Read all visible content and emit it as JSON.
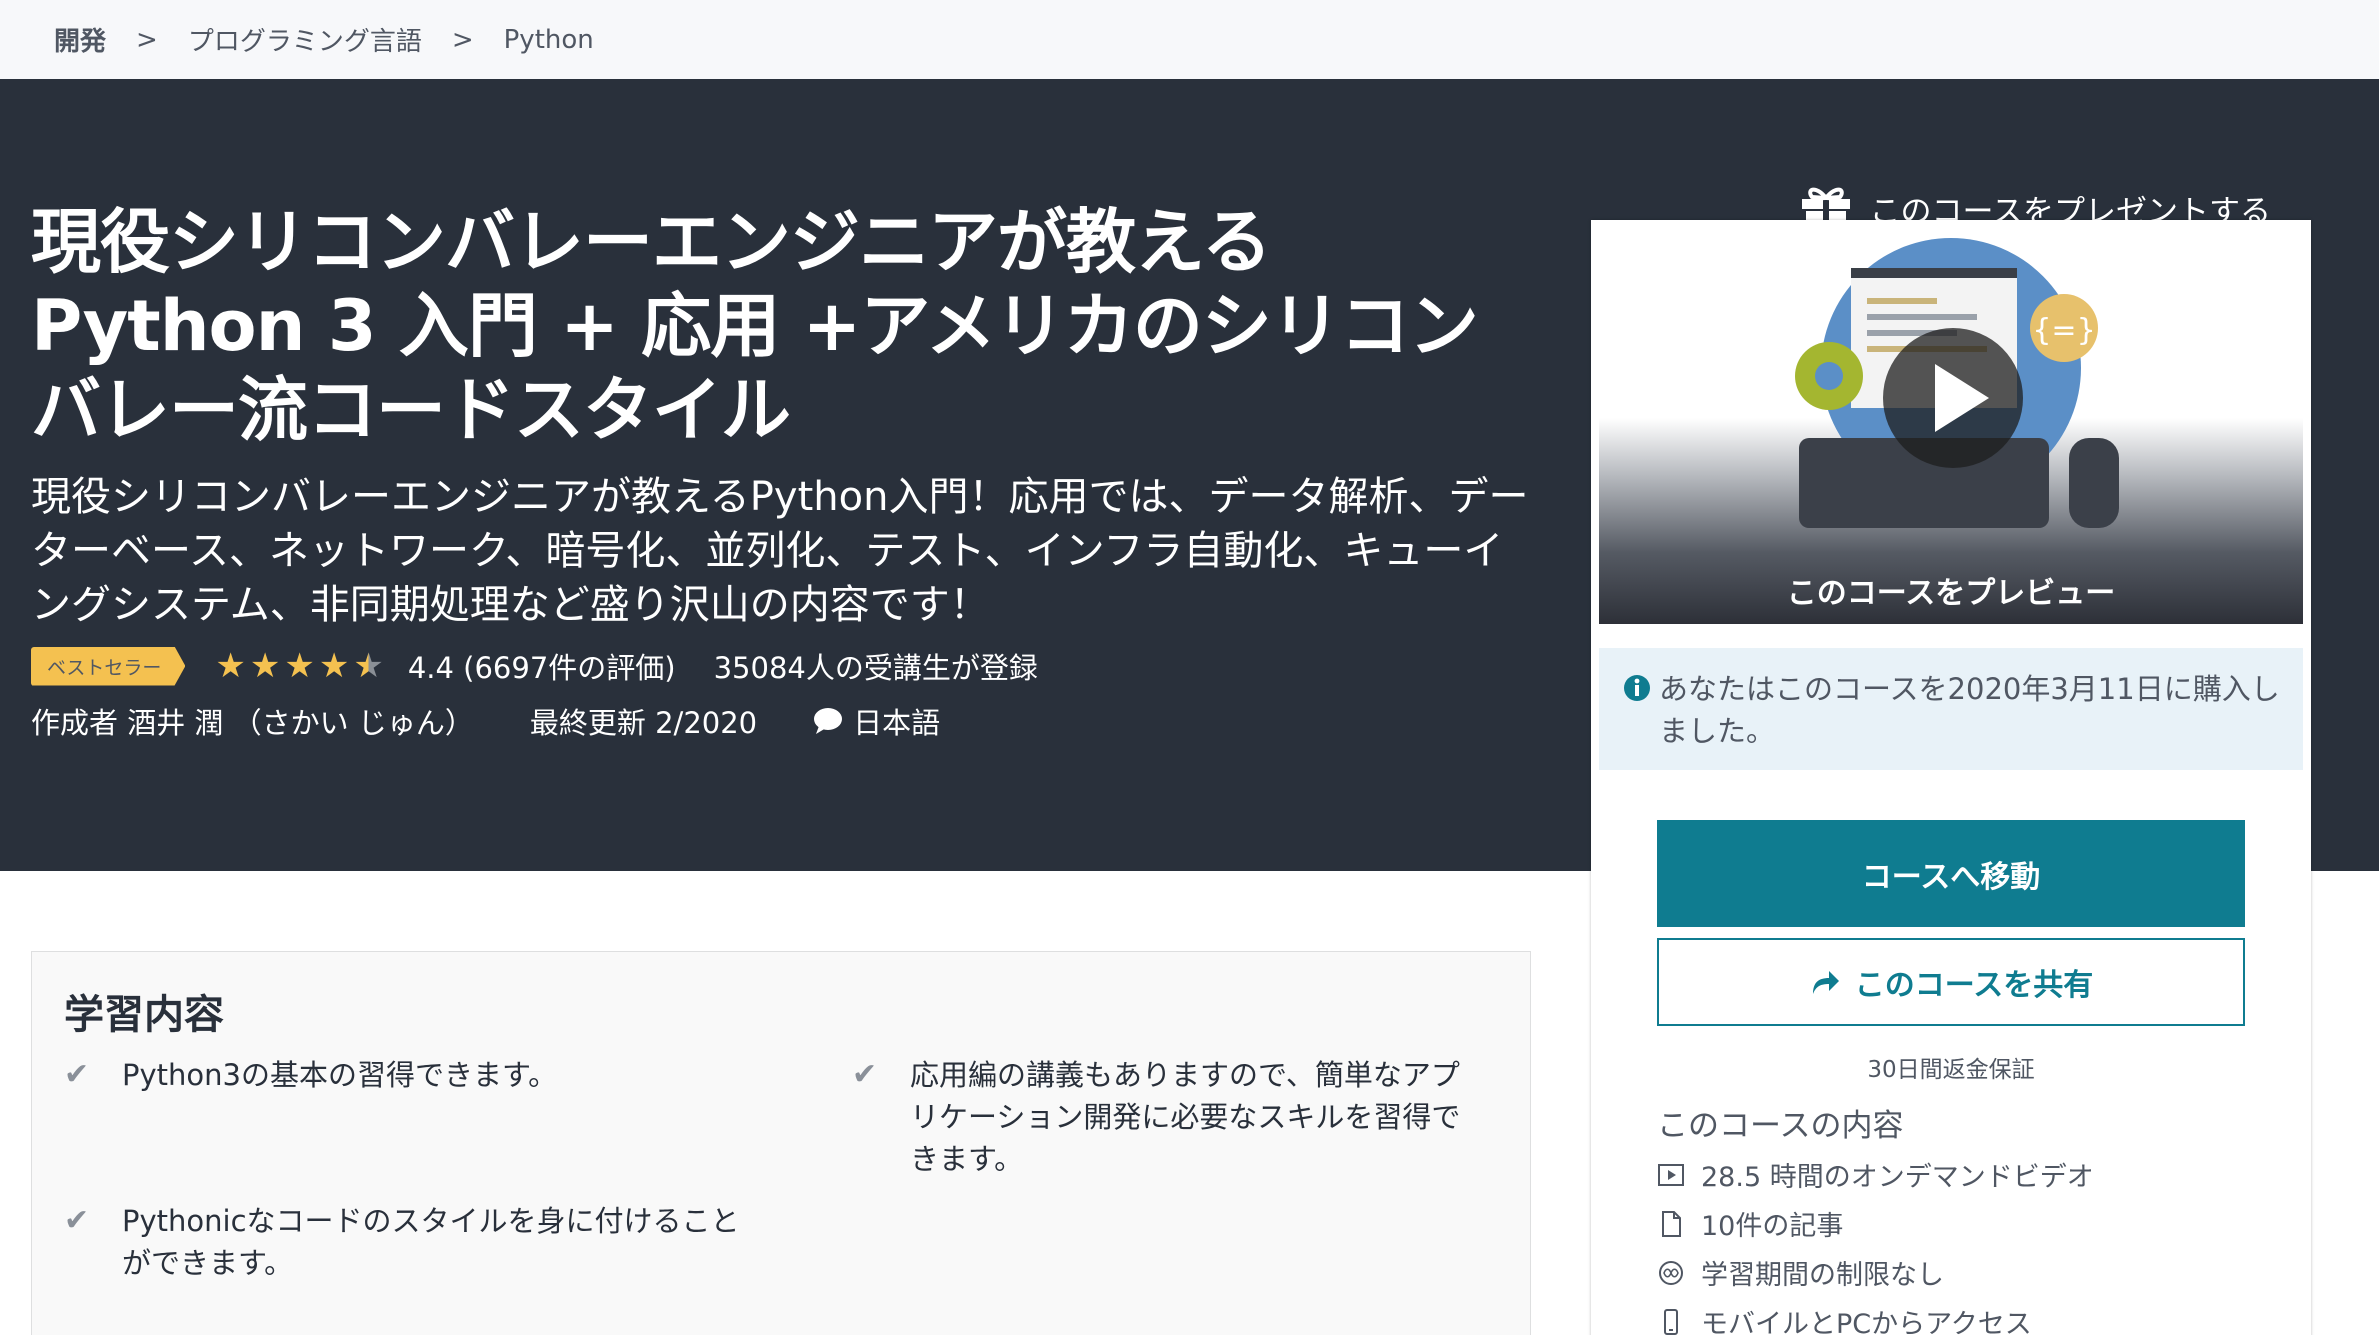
{
  "breadcrumb": {
    "items": [
      "開発",
      "プログラミング言語",
      "Python"
    ],
    "separator": ">"
  },
  "header": {
    "gift_label": "このコースをプレゼントする",
    "title": "現役シリコンバレーエンジニアが教えるPython 3 入門 + 応用 +アメリカのシリコンバレー流コードスタイル",
    "subtitle": "現役シリコンバレーエンジニアが教えるPython入門！応用では、データ解析、データーベース、ネットワーク、暗号化、並列化、テスト、インフラ自動化、キューイングシステム、非同期処理など盛り沢山の内容です！",
    "badge": "ベストセラー",
    "rating": {
      "stars": 4.4,
      "max": 5,
      "text": "4.4 (6697件の評価)"
    },
    "enrolled": "35084人の受講生が登録",
    "author": "作成者 酒井 潤 （さかい じゅん）",
    "updated": "最終更新 2/2020",
    "language": "日本語"
  },
  "sidebar": {
    "preview_label": "このコースをプレビュー",
    "purchase_note": "あなたはこのコースを2020年3月11日に購入しました。",
    "go_button": "コースへ移動",
    "share_button": "このコースを共有",
    "guarantee": "30日間返金保証",
    "includes_title": "このコースの内容",
    "includes": [
      {
        "icon": "video-icon",
        "text": "28.5 時間のオンデマンドビデオ"
      },
      {
        "icon": "file-icon",
        "text": "10件の記事"
      },
      {
        "icon": "infinity-icon",
        "text": "学習期間の制限なし"
      },
      {
        "icon": "mobile-icon",
        "text": "モバイルとPCからアクセス"
      }
    ]
  },
  "learn": {
    "title": "学習内容",
    "points": [
      "Python3の基本の習得できます。",
      "応用編の講義もありますので、簡単なアプリケーション開発に必要なスキルを習得できます。",
      "Pythonicなコードのスタイルを身に付けることができます。"
    ]
  },
  "colors": {
    "hero_bg": "#29303b",
    "accent": "#0f7c90",
    "star": "#f4c150",
    "badge": "#f4c150",
    "info_bg": "#e8f2f8"
  }
}
